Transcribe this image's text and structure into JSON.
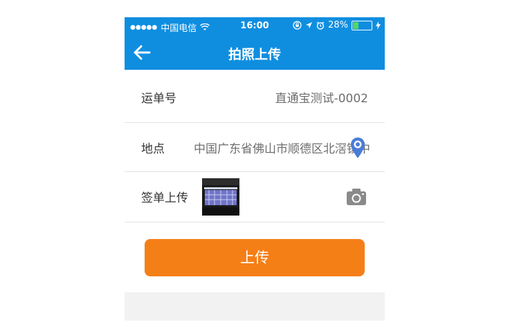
{
  "status_bar": {
    "signal_dots": "●●●●●",
    "carrier": "中国电信",
    "time": "16:00",
    "battery_percent": "28%",
    "battery_level": 0.28
  },
  "nav": {
    "title": "拍照上传"
  },
  "form": {
    "waybill_label": "运单号",
    "waybill_value": "直通宝测试-0002",
    "location_label": "地点",
    "location_value": "中国广东省佛山市顺德区北滘镇中",
    "receipt_label": "签单上传"
  },
  "actions": {
    "upload_label": "上传"
  },
  "colors": {
    "header_blue": "#0f8ee0",
    "button_orange": "#f57f17",
    "pin_blue": "#4a7bd9"
  },
  "icons": {
    "back": "back-arrow-icon",
    "pin": "location-pin-icon",
    "camera": "camera-icon",
    "wifi": "wifi-icon",
    "location_arrow": "location-arrow-icon",
    "alarm": "alarm-icon",
    "lock": "rotation-lock-icon",
    "charging": "charging-icon"
  }
}
